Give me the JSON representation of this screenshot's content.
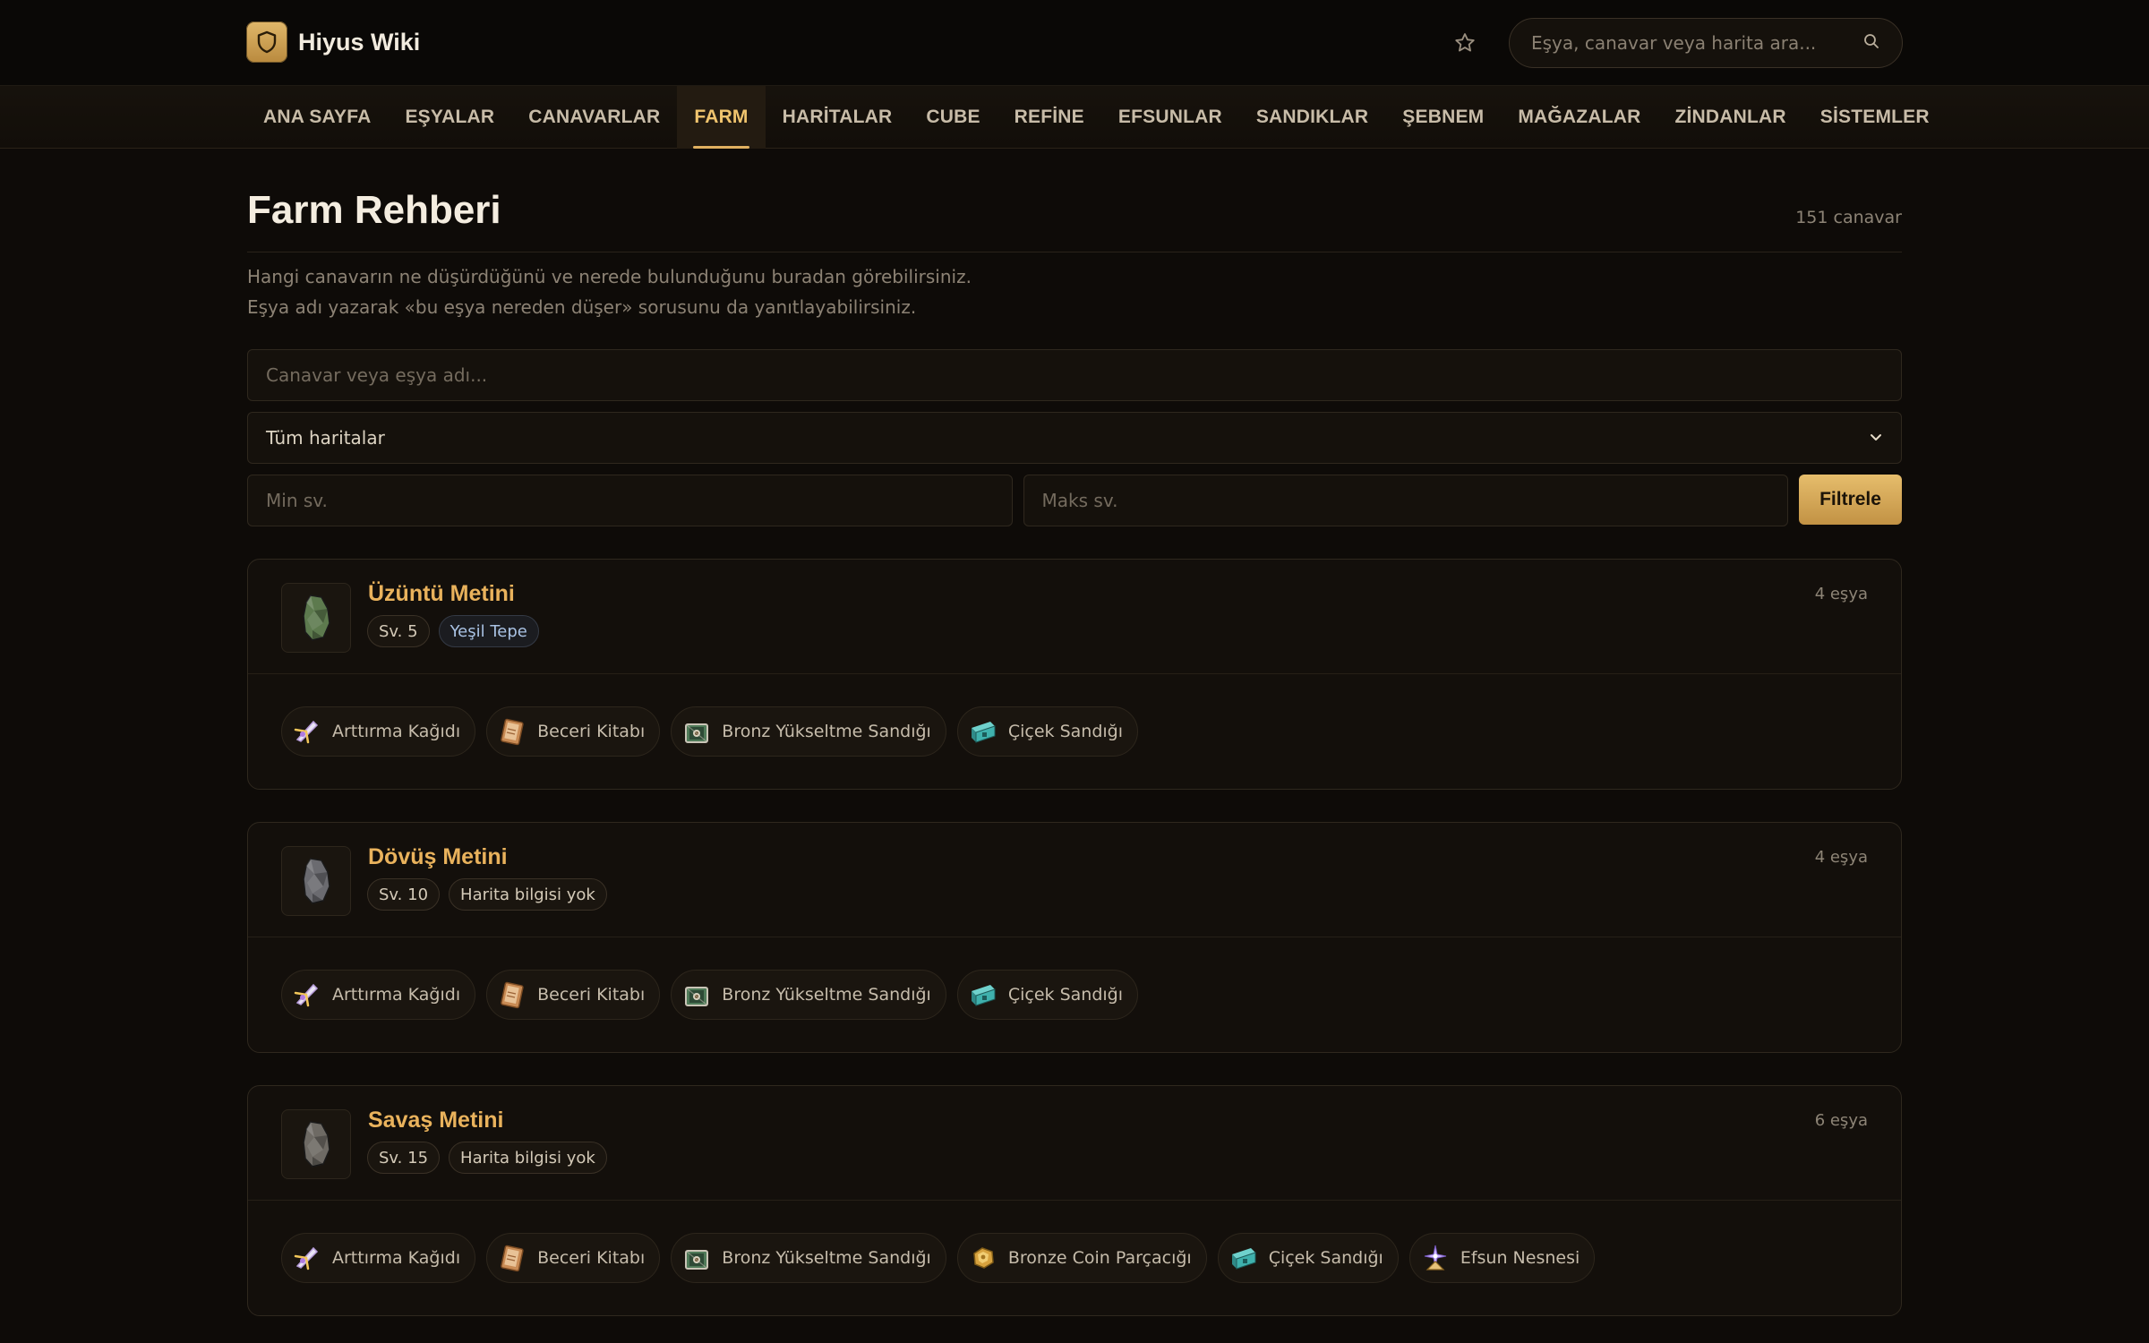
{
  "header": {
    "brand": "Hiyus Wiki",
    "search_placeholder": "Eşya, canavar veya harita ara..."
  },
  "nav": {
    "items": [
      {
        "label": "ANA SAYFA"
      },
      {
        "label": "EŞYALAR"
      },
      {
        "label": "CANAVARLAR"
      },
      {
        "label": "FARM",
        "active": true
      },
      {
        "label": "HARİTALAR"
      },
      {
        "label": "CUBE"
      },
      {
        "label": "REFİNE"
      },
      {
        "label": "EFSUNLAR"
      },
      {
        "label": "SANDIKLAR"
      },
      {
        "label": "ŞEBNEM"
      },
      {
        "label": "MAĞAZALAR"
      },
      {
        "label": "ZİNDANLAR"
      },
      {
        "label": "SİSTEMLER"
      }
    ]
  },
  "page": {
    "title": "Farm Rehberi",
    "count": "151 canavar",
    "description": "Hangi canavarın ne düşürdüğünü ve nerede bulunduğunu buradan görebilirsiniz. Eşya adı yazarak «bu eşya nereden düşer» sorusunu da yanıtlayabilirsiniz."
  },
  "filters": {
    "search_placeholder": "Canavar veya eşya adı...",
    "map_select": "Tüm haritalar",
    "min_placeholder": "Min sv.",
    "max_placeholder": "Maks sv.",
    "filter_button": "Filtrele"
  },
  "monsters": [
    {
      "name": "Üzüntü Metini",
      "level": "Sv. 5",
      "map": "Yeşil Tepe",
      "map_known": true,
      "item_count": "4 eşya",
      "stone_color": "#5d7a4e",
      "drops": [
        {
          "name": "Arttırma Kağıdı",
          "icon": "scroll-icon"
        },
        {
          "name": "Beceri Kitabı",
          "icon": "book-icon"
        },
        {
          "name": "Bronz Yükseltme Sandığı",
          "icon": "chest-icon"
        },
        {
          "name": "Çiçek Sandığı",
          "icon": "teal-chest-icon"
        }
      ]
    },
    {
      "name": "Dövüş Metini",
      "level": "Sv. 10",
      "map": "Harita bilgisi yok",
      "map_known": false,
      "item_count": "4 eşya",
      "stone_color": "#6b6b70",
      "drops": [
        {
          "name": "Arttırma Kağıdı",
          "icon": "scroll-icon"
        },
        {
          "name": "Beceri Kitabı",
          "icon": "book-icon"
        },
        {
          "name": "Bronz Yükseltme Sandığı",
          "icon": "chest-icon"
        },
        {
          "name": "Çiçek Sandığı",
          "icon": "teal-chest-icon"
        }
      ]
    },
    {
      "name": "Savaş Metini",
      "level": "Sv. 15",
      "map": "Harita bilgisi yok",
      "map_known": false,
      "item_count": "6 eşya",
      "stone_color": "#6e6a64",
      "drops": [
        {
          "name": "Arttırma Kağıdı",
          "icon": "scroll-icon"
        },
        {
          "name": "Beceri Kitabı",
          "icon": "book-icon"
        },
        {
          "name": "Bronz Yükseltme Sandığı",
          "icon": "chest-icon"
        },
        {
          "name": "Bronze Coin Parçacığı",
          "icon": "coin-icon"
        },
        {
          "name": "Çiçek Sandığı",
          "icon": "teal-chest-icon"
        },
        {
          "name": "Efsun Nesnesi",
          "icon": "enchant-icon"
        }
      ]
    }
  ]
}
